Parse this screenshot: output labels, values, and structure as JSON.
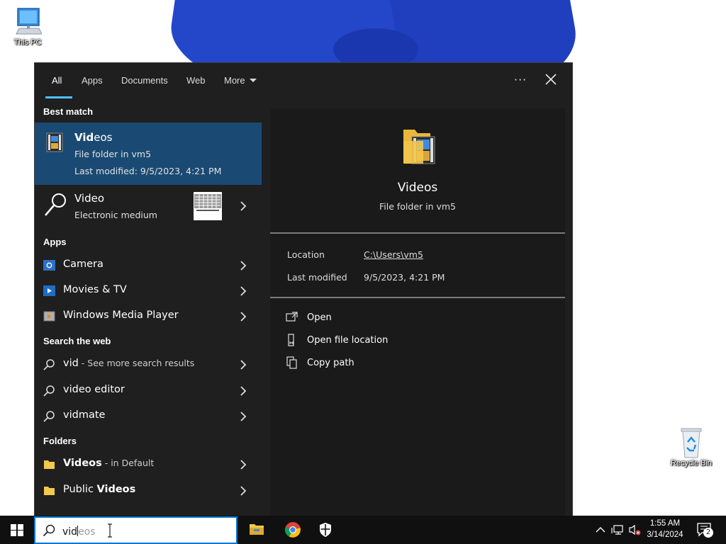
{
  "desktop": {
    "icons": [
      {
        "label": "This PC"
      },
      {
        "label": "Recycle Bin"
      }
    ]
  },
  "search_panel": {
    "tabs": [
      {
        "label": "All",
        "active": true
      },
      {
        "label": "Apps"
      },
      {
        "label": "Documents"
      },
      {
        "label": "Web"
      },
      {
        "label": "More"
      }
    ],
    "options_glyph": "···",
    "sections": {
      "best_match": "Best match",
      "apps": "Apps",
      "search_web": "Search the web",
      "folders": "Folders"
    },
    "best_match": {
      "title_bold": "Vid",
      "title_rest": "eos",
      "subtitle": "File folder in vm5",
      "modified": "Last modified: 9/5/2023, 4:21 PM"
    },
    "definition": {
      "title": "Video",
      "subtitle": "Electronic medium"
    },
    "apps": [
      {
        "label": "Camera",
        "icon": "camera-icon"
      },
      {
        "label": "Movies & TV",
        "icon": "movies-tv-icon"
      },
      {
        "label": "Windows Media Player",
        "icon": "media-player-icon"
      }
    ],
    "web": [
      {
        "bold": "vid",
        "rest": " - See more search results"
      },
      {
        "bold": "video editor",
        "rest": ""
      },
      {
        "bold": "vidmate",
        "rest": ""
      }
    ],
    "folders": [
      {
        "bold": "Videos",
        "rest": " - in Default"
      },
      {
        "plain": "Public ",
        "bold": "Videos"
      }
    ],
    "detail": {
      "title": "Videos",
      "subtitle": "File folder in vm5",
      "location_label": "Location",
      "location_value": "C:\\Users\\vm5",
      "modified_label": "Last modified",
      "modified_value": "9/5/2023, 4:21 PM",
      "actions": [
        {
          "label": "Open",
          "icon": "open-icon"
        },
        {
          "label": "Open file location",
          "icon": "file-location-icon"
        },
        {
          "label": "Copy path",
          "icon": "copy-path-icon"
        }
      ]
    }
  },
  "taskbar": {
    "search_typed": "vid",
    "search_suggestion": "eos",
    "clock_time": "1:55 AM",
    "clock_date": "3/14/2024",
    "notification_count": "2"
  },
  "colors": {
    "panel_bg": "#1f1f1f",
    "selected_bg": "#1a4a73",
    "accent": "#4cc2ff",
    "taskbar_bg": "#101010"
  }
}
